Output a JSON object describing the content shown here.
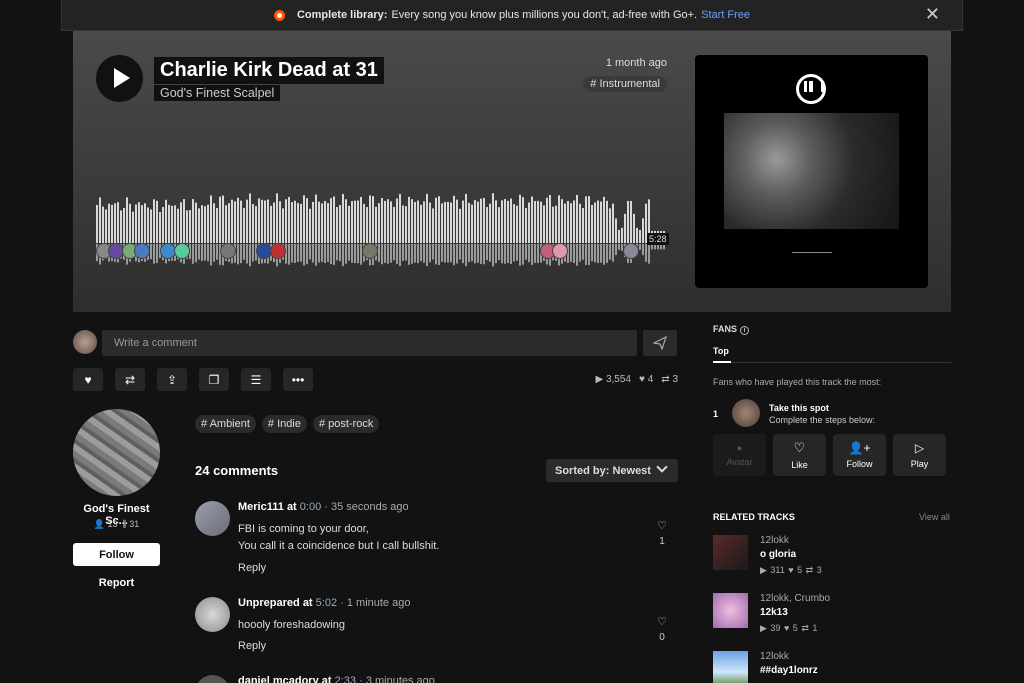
{
  "banner": {
    "bold": "Complete library:",
    "text": "Every song you know plus millions you don't, ad-free with Go+.",
    "link": "Start Free"
  },
  "track": {
    "title": "Charlie Kirk Dead at 31",
    "artist": "God's Finest Scalpel",
    "posted": "1 month ago",
    "genre": "# Instrumental",
    "duration": "5:28"
  },
  "comment_box": {
    "placeholder": "Write a comment"
  },
  "stats": {
    "plays": "3,554",
    "likes": "4",
    "reposts": "3"
  },
  "uploader": {
    "name": "God's Finest Sc...",
    "followers": "13",
    "tracks": "31",
    "follow_label": "Follow",
    "report_label": "Report"
  },
  "tags": [
    "# Ambient",
    "# Indie",
    "# post-rock"
  ],
  "comments_header": {
    "count": "24 comments",
    "sort": "Sorted by: Newest"
  },
  "comments": [
    {
      "user": "Meric111",
      "at": "at",
      "ts": "0:00",
      "ago": "· 35 seconds ago",
      "lines": [
        "FBI is coming to your door,",
        "You call it a coincidence but I call bullshit."
      ],
      "reply": "Reply",
      "likes": "1"
    },
    {
      "user": "Unprepared",
      "at": "at",
      "ts": "5:02",
      "ago": "· 1 minute ago",
      "lines": [
        "hoooly foreshadowing"
      ],
      "reply": "Reply",
      "likes": "0"
    },
    {
      "user": "daniel mcadory",
      "at": "at",
      "ts": "2:33",
      "ago": "· 3 minutes ago",
      "lines": [],
      "reply": "",
      "likes": ""
    }
  ],
  "fans": {
    "title": "FANS",
    "tab": "Top",
    "desc": "Fans who have played this track the most:",
    "rank": "1",
    "head": "Take this spot",
    "sub": "Complete the steps below:",
    "steps": [
      "Avatar",
      "Like",
      "Follow",
      "Play"
    ]
  },
  "related": {
    "title": "RELATED TRACKS",
    "view_all": "View all",
    "items": [
      {
        "user": "12lokk",
        "title": "o gloria",
        "plays": "311",
        "likes": "5",
        "reposts": "3"
      },
      {
        "user": "12lokk, Crumbo",
        "title": "12k13",
        "plays": "39",
        "likes": "5",
        "reposts": "1"
      },
      {
        "user": "12lokk",
        "title": "##day1lonrz",
        "plays": "",
        "likes": "",
        "reposts": ""
      }
    ]
  },
  "colors": {
    "accent": "#ff5500",
    "link": "#63a4ff",
    "background": "#121212"
  }
}
